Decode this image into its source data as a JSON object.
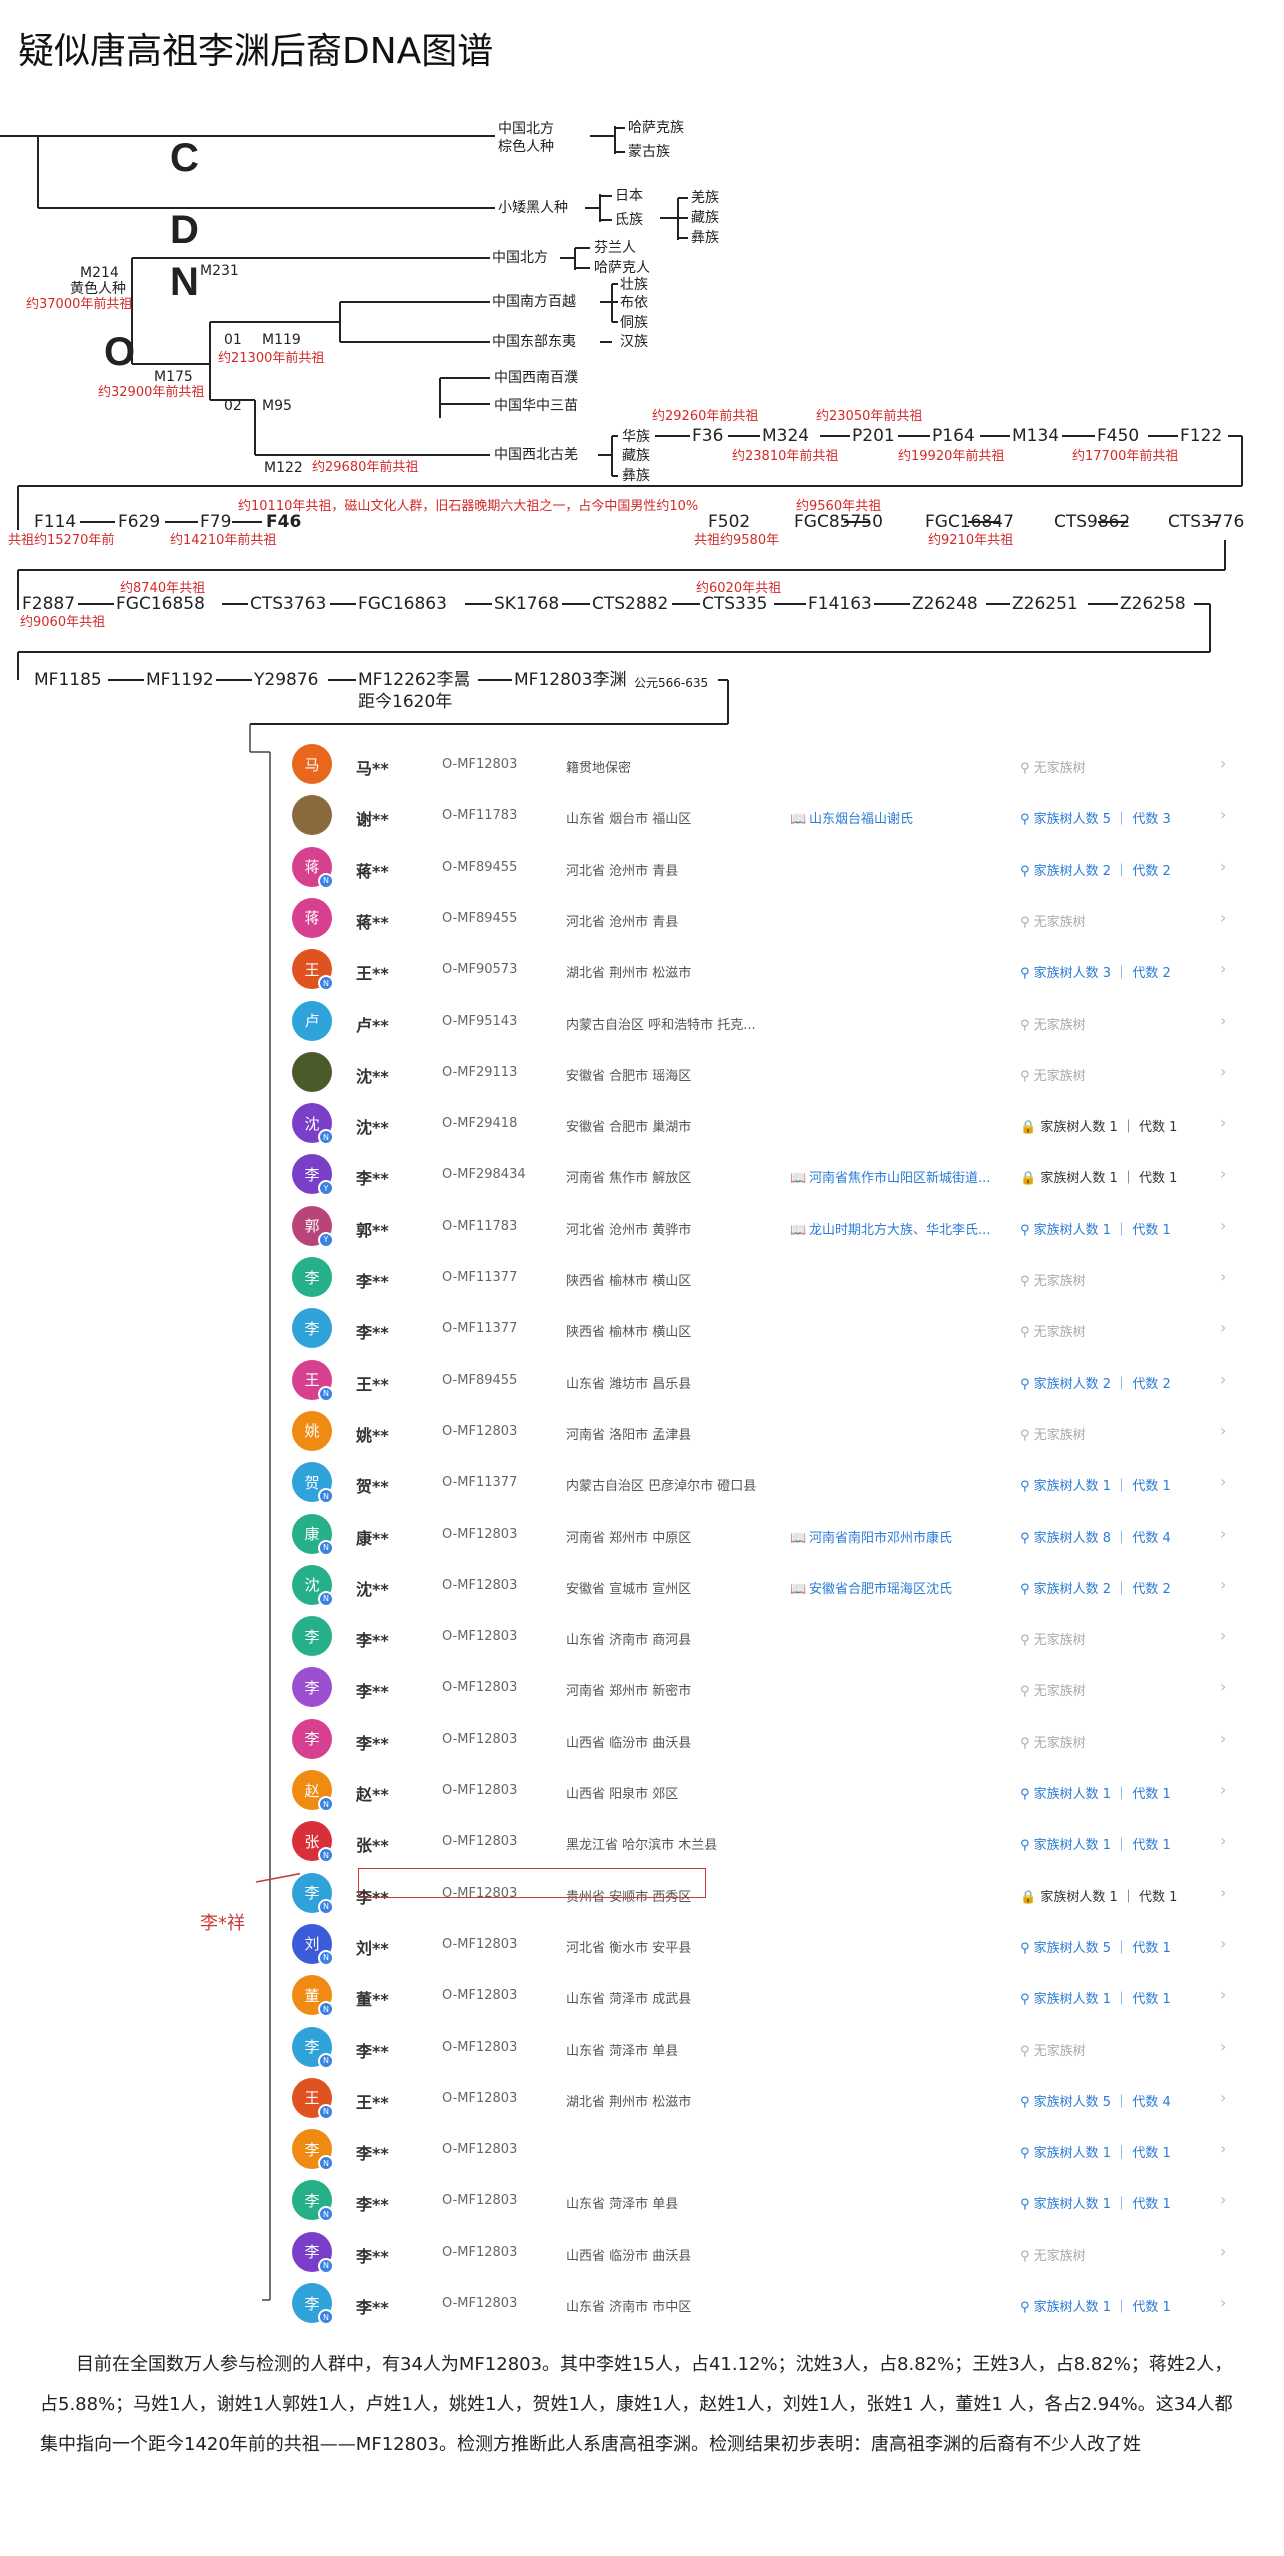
{
  "title": "疑似唐高祖李渊后裔DNA图谱",
  "haplogroups": {
    "C": "C",
    "D": "D",
    "N": "N",
    "O": "O"
  },
  "tree": {
    "north_brown": "中国北方\n棕色人种",
    "kazakh": "哈萨克族",
    "mongol": "蒙古族",
    "little_black": "小矮黑人种",
    "japan": "日本",
    "di": "氐族",
    "qiang": "羌族",
    "zang1": "藏族",
    "yi1": "彝族",
    "north2": "中国北方",
    "m231": "M231",
    "finn": "芬兰人",
    "khakas": "哈萨克人",
    "m214": "M214",
    "yellow": "黄色人种",
    "yellow_age": "约37000年前共祖",
    "south_baiyue": "中国南方百越",
    "zhuang": "壮族",
    "buyi": "布依",
    "dong": "侗族",
    "east_dongyi": "中国东部东夷",
    "han": "汉族",
    "o1": "01",
    "m119": "M119",
    "o1_age": "约21300年前共祖",
    "m175": "M175",
    "m175_age": "约32900年前共祖",
    "sw_baipu": "中国西南百濮",
    "huazhong_sanmiao": "中国华中三苗",
    "o2": "02",
    "m95": "M95",
    "nw_guqiang": "中国西北古羌",
    "huazu": "华族",
    "zang2": "藏族",
    "yi2": "彝族",
    "m122": "M122",
    "m122_age": "约29680年前共祖",
    "snp_row1": [
      "F36",
      "M324",
      "P201",
      "P164",
      "M134",
      "F450",
      "F122"
    ],
    "row1_ages_top": [
      "约29260年前共祖",
      "约23050年前共祖"
    ],
    "row1_ages_bottom": [
      "约23810年前共祖",
      "约19920年前共祖",
      "约17700年前共祖"
    ],
    "snp_row2": [
      "F114",
      "F629",
      "F79",
      "F46",
      "F502",
      "FGC85750",
      "FGC16847",
      "CTS9862",
      "CTS3776"
    ],
    "row2_notes": {
      "f114_age": "共祖约15270年前",
      "f79_age": "约14210年前共祖",
      "f46_desc": "约10110年共祖，磁山文化人群，旧石器晚期六大祖之一，占今中国男性约10%",
      "f502_age": "共祖约9580年",
      "fgc85750_age": "约9560年共祖",
      "fgc16847_age": "约9210年共祖"
    },
    "snp_row3": [
      "F2887",
      "FGC16858",
      "CTS3763",
      "FGC16863",
      "SK1768",
      "CTS2882",
      "CTS335",
      "F14163",
      "Z26248",
      "Z26251",
      "Z26258"
    ],
    "row3_notes": {
      "f2887_age": "约9060年共祖",
      "fgc16858_age": "约8740年共祖",
      "cts335_age": "约6020年共祖"
    },
    "snp_row4": [
      "MF1185",
      "MF1192",
      "Y29876",
      "MF12262李暠",
      "MF12803李渊"
    ],
    "li_yuan_years": "公元566-635",
    "distance": "距今1620年"
  },
  "members": [
    {
      "avatar": "马",
      "color": "#e8671d",
      "name": "马**",
      "code": "O-MF12803",
      "loc": "籍贯地保密",
      "clan": "",
      "tree": "无家族树",
      "tone": "gray",
      "badge": ""
    },
    {
      "avatar": "",
      "color": "#8a6a3c",
      "name": "谢**",
      "code": "O-MF11783",
      "loc": "山东省 烟台市 福山区",
      "clan": "山东烟台福山谢氏",
      "tree": "家族树人数 5 ｜ 代数 3",
      "tone": "blue",
      "badge": ""
    },
    {
      "avatar": "蒋",
      "color": "#d6408f",
      "name": "蒋**",
      "code": "O-MF89455",
      "loc": "河北省 沧州市 青县",
      "clan": "",
      "tree": "家族树人数 2 ｜ 代数 2",
      "tone": "blue",
      "badge": "N"
    },
    {
      "avatar": "蒋",
      "color": "#d6408f",
      "name": "蒋**",
      "code": "O-MF89455",
      "loc": "河北省 沧州市 青县",
      "clan": "",
      "tree": "无家族树",
      "tone": "gray",
      "badge": ""
    },
    {
      "avatar": "王",
      "color": "#e0521f",
      "name": "王**",
      "code": "O-MF90573",
      "loc": "湖北省 荆州市 松滋市",
      "clan": "",
      "tree": "家族树人数 3 ｜ 代数 2",
      "tone": "blue",
      "badge": "N"
    },
    {
      "avatar": "卢",
      "color": "#2fa3d9",
      "name": "卢**",
      "code": "O-MF95143",
      "loc": "内蒙古自治区 呼和浩特市 托克...",
      "clan": "",
      "tree": "无家族树",
      "tone": "gray",
      "badge": ""
    },
    {
      "avatar": "",
      "color": "#4a5a2a",
      "name": "沈**",
      "code": "O-MF29113",
      "loc": "安徽省 合肥市 瑶海区",
      "clan": "",
      "tree": "无家族树",
      "tone": "gray",
      "badge": ""
    },
    {
      "avatar": "沈",
      "color": "#7a3fc9",
      "name": "沈**",
      "code": "O-MF29418",
      "loc": "安徽省 合肥市 巢湖市",
      "clan": "",
      "tree": "家族树人数 1 ｜ 代数 1",
      "tone": "dark",
      "badge": "N"
    },
    {
      "avatar": "李",
      "color": "#7a3fc9",
      "name": "李**",
      "code": "O-MF298434",
      "loc": "河南省 焦作市 解放区",
      "clan": "河南省焦作市山阳区新城街道...",
      "tree": "家族树人数 1 ｜ 代数 1",
      "tone": "dark",
      "badge": "Y"
    },
    {
      "avatar": "郭",
      "color": "#b8457a",
      "name": "郭**",
      "code": "O-MF11783",
      "loc": "河北省 沧州市 黄骅市",
      "clan": "龙山时期北方大族、华北李氏...",
      "tree": "家族树人数 1 ｜ 代数 1",
      "tone": "blue",
      "badge": "Y"
    },
    {
      "avatar": "李",
      "color": "#25b08a",
      "name": "李**",
      "code": "O-MF11377",
      "loc": "陕西省 榆林市 横山区",
      "clan": "",
      "tree": "无家族树",
      "tone": "gray",
      "badge": ""
    },
    {
      "avatar": "李",
      "color": "#2fa3d9",
      "name": "李**",
      "code": "O-MF11377",
      "loc": "陕西省 榆林市 横山区",
      "clan": "",
      "tree": "无家族树",
      "tone": "gray",
      "badge": ""
    },
    {
      "avatar": "王",
      "color": "#d6408f",
      "name": "王**",
      "code": "O-MF89455",
      "loc": "山东省 潍坊市 昌乐县",
      "clan": "",
      "tree": "家族树人数 2 ｜ 代数 2",
      "tone": "blue",
      "badge": "N"
    },
    {
      "avatar": "姚",
      "color": "#ef8a12",
      "name": "姚**",
      "code": "O-MF12803",
      "loc": "河南省 洛阳市 孟津县",
      "clan": "",
      "tree": "无家族树",
      "tone": "gray",
      "badge": ""
    },
    {
      "avatar": "贺",
      "color": "#2fa3d9",
      "name": "贺**",
      "code": "O-MF11377",
      "loc": "内蒙古自治区 巴彦淖尔市 磴口县",
      "clan": "",
      "tree": "家族树人数 1 ｜ 代数 1",
      "tone": "blue",
      "badge": "N"
    },
    {
      "avatar": "康",
      "color": "#25b08a",
      "name": "康**",
      "code": "O-MF12803",
      "loc": "河南省 郑州市 中原区",
      "clan": "河南省南阳市邓州市康氏",
      "tree": "家族树人数 8 ｜ 代数 4",
      "tone": "blue",
      "badge": "N"
    },
    {
      "avatar": "沈",
      "color": "#25b08a",
      "name": "沈**",
      "code": "O-MF12803",
      "loc": "安徽省 宣城市 宣州区",
      "clan": "安徽省合肥市瑶海区沈氏",
      "tree": "家族树人数 2 ｜ 代数 2",
      "tone": "blue",
      "badge": "N"
    },
    {
      "avatar": "李",
      "color": "#25b08a",
      "name": "李**",
      "code": "O-MF12803",
      "loc": "山东省 济南市 商河县",
      "clan": "",
      "tree": "无家族树",
      "tone": "gray",
      "badge": ""
    },
    {
      "avatar": "李",
      "color": "#9b4fd0",
      "name": "李**",
      "code": "O-MF12803",
      "loc": "河南省 郑州市 新密市",
      "clan": "",
      "tree": "无家族树",
      "tone": "gray",
      "badge": ""
    },
    {
      "avatar": "李",
      "color": "#d6408f",
      "name": "李**",
      "code": "O-MF12803",
      "loc": "山西省 临汾市 曲沃县",
      "clan": "",
      "tree": "无家族树",
      "tone": "gray",
      "badge": ""
    },
    {
      "avatar": "赵",
      "color": "#ef8a12",
      "name": "赵**",
      "code": "O-MF12803",
      "loc": "山西省 阳泉市 郊区",
      "clan": "",
      "tree": "家族树人数 1 ｜ 代数 1",
      "tone": "blue",
      "badge": "N"
    },
    {
      "avatar": "张",
      "color": "#d92f3a",
      "name": "张**",
      "code": "O-MF12803",
      "loc": "黑龙江省 哈尔滨市 木兰县",
      "clan": "",
      "tree": "家族树人数 1 ｜ 代数 1",
      "tone": "blue",
      "badge": "N"
    },
    {
      "avatar": "李",
      "color": "#2fa3d9",
      "name": "李**",
      "code": "O-MF12803",
      "loc": "贵州省 安顺市 西秀区",
      "clan": "",
      "tree": "家族树人数 1 ｜ 代数 1",
      "tone": "dark",
      "badge": "N"
    },
    {
      "avatar": "刘",
      "color": "#3b5bd9",
      "name": "刘**",
      "code": "O-MF12803",
      "loc": "河北省 衡水市 安平县",
      "clan": "",
      "tree": "家族树人数 5 ｜ 代数 1",
      "tone": "blue",
      "badge": "N"
    },
    {
      "avatar": "董",
      "color": "#ef8a12",
      "name": "董**",
      "code": "O-MF12803",
      "loc": "山东省 菏泽市 成武县",
      "clan": "",
      "tree": "家族树人数 1 ｜ 代数 1",
      "tone": "blue",
      "badge": "N"
    },
    {
      "avatar": "李",
      "color": "#2fa3d9",
      "name": "李**",
      "code": "O-MF12803",
      "loc": "山东省 菏泽市 单县",
      "clan": "",
      "tree": "无家族树",
      "tone": "gray",
      "badge": "N"
    },
    {
      "avatar": "王",
      "color": "#e0521f",
      "name": "王**",
      "code": "O-MF12803",
      "loc": "湖北省 荆州市 松滋市",
      "clan": "",
      "tree": "家族树人数 5 ｜ 代数 4",
      "tone": "blue",
      "badge": "N"
    },
    {
      "avatar": "李",
      "color": "#ef8a12",
      "name": "李**",
      "code": "O-MF12803",
      "loc": "",
      "clan": "",
      "tree": "家族树人数 1 ｜ 代数 1",
      "tone": "blue",
      "badge": "N"
    },
    {
      "avatar": "李",
      "color": "#25b08a",
      "name": "李**",
      "code": "O-MF12803",
      "loc": "山东省 菏泽市 单县",
      "clan": "",
      "tree": "家族树人数 1 ｜ 代数 1",
      "tone": "blue",
      "badge": "N"
    },
    {
      "avatar": "李",
      "color": "#7a3fc9",
      "name": "李**",
      "code": "O-MF12803",
      "loc": "山西省 临汾市 曲沃县",
      "clan": "",
      "tree": "无家族树",
      "tone": "gray",
      "badge": "N"
    },
    {
      "avatar": "李",
      "color": "#2fa3d9",
      "name": "李**",
      "code": "O-MF12803",
      "loc": "山东省 济南市 市中区",
      "clan": "",
      "tree": "家族树人数 1 ｜ 代数 1",
      "tone": "blue",
      "badge": "N"
    }
  ],
  "callout": "李*祥",
  "summary": "目前在全国数万人参与检测的人群中，有34人为MF12803。其中李姓15人，占41.12%；沈姓3人，占8.82%；王姓3人，占8.82%；蒋姓2人，占5.88%；马姓1人，谢姓1人郭姓1人，卢姓1人，姚姓1人，贺姓1人，康姓1人，赵姓1人，刘姓1人，张姓1 人，董姓1 人，各占2.94%。这34人都集中指向一个距今1420年前的共祖——MF12803。检测方推断此人系唐高祖李渊。检测结果初步表明：唐高祖李渊的后裔有不少人改了姓"
}
